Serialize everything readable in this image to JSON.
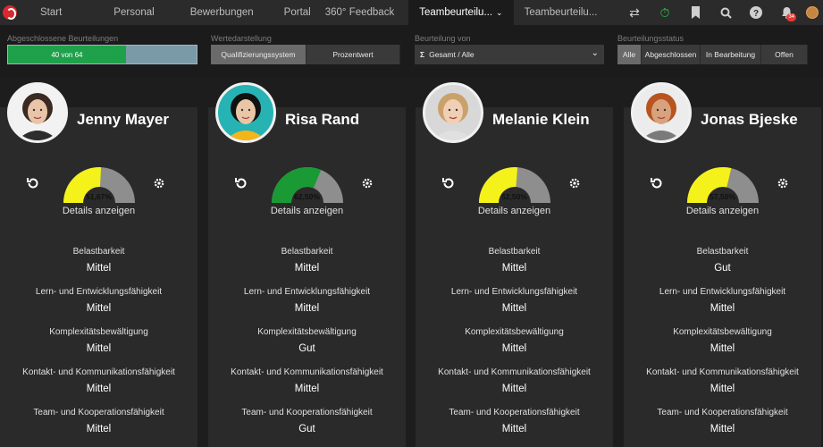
{
  "nav": {
    "items": [
      {
        "label": "Start"
      },
      {
        "label": "Personal"
      },
      {
        "label": "Bewerbungen"
      },
      {
        "label": "Portal"
      },
      {
        "label": "360° Feedback"
      },
      {
        "label": "Teambeurteilu..."
      },
      {
        "label": "Teambeurteilu..."
      }
    ],
    "active_chevron": "⌄",
    "notification_count": "34"
  },
  "filters": {
    "completed": {
      "label": "Abgeschlossene Beurteilungen",
      "text": "40 von 64",
      "value": 40,
      "total": 64
    },
    "display": {
      "label": "Wertedarstellung",
      "options": [
        "Qualifizierungssystem",
        "Prozentwert"
      ],
      "selected": "Qualifizierungssystem"
    },
    "source": {
      "label": "Beurteilung von",
      "value": "Gesamt / Alle",
      "icon": "Σ"
    },
    "status": {
      "label": "Beurteilungsstatus",
      "options": [
        "Alle",
        "Abgeschlossen",
        "In Bearbeitung",
        "Offen"
      ],
      "selected": "Alle"
    }
  },
  "details_label": "Details anzeigen",
  "criteria_labels": [
    "Belastbarkeit",
    "Lern- und Entwicklungsfähigkeit",
    "Komplexitätsbewältigung",
    "Kontakt- und Kommunikationsfähigkeit",
    "Team- und Kooperationsfähigkeit"
  ],
  "employees": [
    {
      "name": "Jenny Mayer",
      "score_text": "51,67%",
      "score": 51.67,
      "color": "#f4f21a",
      "values": [
        "Mittel",
        "Mittel",
        "Mittel",
        "Mittel",
        "Mittel"
      ]
    },
    {
      "name": "Risa Rand",
      "score_text": "62,50%",
      "score": 62.5,
      "color": "#1a9a34",
      "values": [
        "Mittel",
        "Mittel",
        "Gut",
        "Mittel",
        "Gut"
      ]
    },
    {
      "name": "Melanie Klein",
      "score_text": "52,50%",
      "score": 52.5,
      "color": "#f4f21a",
      "values": [
        "Mittel",
        "Mittel",
        "Mittel",
        "Mittel",
        "Mittel"
      ]
    },
    {
      "name": "Jonas Bjeske",
      "score_text": "57,50%",
      "score": 57.5,
      "color": "#f4f21a",
      "values": [
        "Gut",
        "Mittel",
        "Mittel",
        "Mittel",
        "Mittel"
      ]
    }
  ],
  "colors": {
    "gauge_rest": "#8e8e8e",
    "progress_fill": "#1fa04a"
  }
}
